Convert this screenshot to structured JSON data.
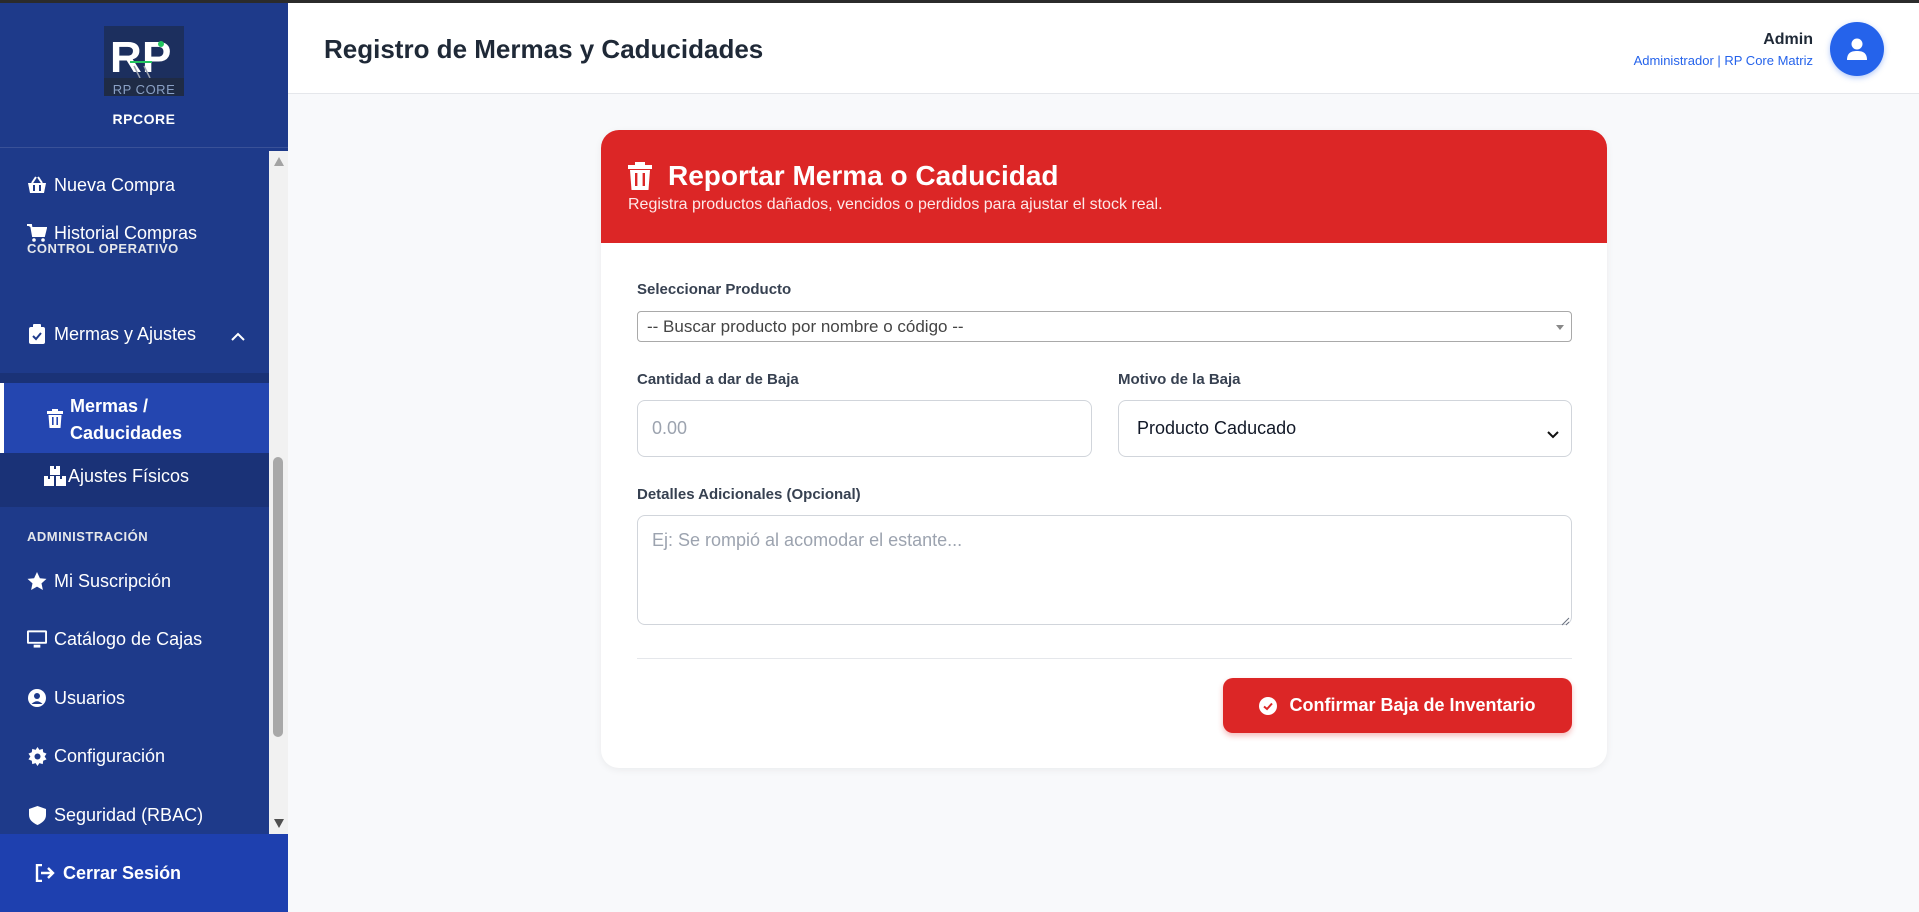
{
  "app": {
    "brand_name": "RPCORE",
    "logo_text": "RP",
    "logo_subtext": "RP CORE"
  },
  "header": {
    "page_title": "Registro de Mermas y Caducidades",
    "user_name": "Admin",
    "user_role": "Administrador | RP Core Matriz"
  },
  "sidebar": {
    "items_top": [
      {
        "label": "Nueva Compra",
        "icon": "basket-icon"
      },
      {
        "label": "Historial Compras",
        "icon": "cart-icon"
      }
    ],
    "section_control": "CONTROL OPERATIVO",
    "group_mermas": {
      "label": "Mermas y Ajustes",
      "icon": "clipboard-check-icon",
      "expanded": true
    },
    "sub_items": [
      {
        "label": "Mermas / Caducidades",
        "line1": "Mermas /",
        "line2": "Caducidades",
        "icon": "trash-icon",
        "active": true
      },
      {
        "label": "Ajustes Físicos",
        "icon": "boxes-icon",
        "active": false
      }
    ],
    "section_admin": "ADMINISTRACIÓN",
    "items_admin": [
      {
        "label": "Mi Suscripción",
        "icon": "star-icon"
      },
      {
        "label": "Catálogo de Cajas",
        "icon": "monitor-icon"
      },
      {
        "label": "Usuarios",
        "icon": "user-circle-icon"
      },
      {
        "label": "Configuración",
        "icon": "gear-icon"
      },
      {
        "label": "Seguridad (RBAC)",
        "icon": "shield-icon"
      }
    ],
    "logout_label": "Cerrar Sesión"
  },
  "form": {
    "title": "Reportar Merma o Caducidad",
    "subtitle": "Registra productos dañados, vencidos o perdidos para ajustar el stock real.",
    "product_label": "Seleccionar Producto",
    "product_placeholder": "-- Buscar producto por nombre o código --",
    "qty_label": "Cantidad a dar de Baja",
    "qty_placeholder": "0.00",
    "reason_label": "Motivo de la Baja",
    "reason_value": "Producto Caducado",
    "details_label": "Detalles Adicionales (Opcional)",
    "details_placeholder": "Ej: Se rompió al acomodar el estante...",
    "submit_label": "Confirmar Baja de Inventario"
  },
  "colors": {
    "sidebar_bg": "#1e3a8a",
    "accent_blue": "#2563eb",
    "danger_red": "#dc2626"
  }
}
